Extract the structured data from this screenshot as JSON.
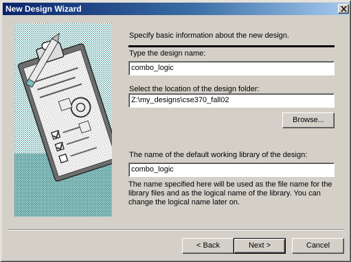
{
  "window": {
    "title": "New Design Wizard",
    "close_icon": "close-icon"
  },
  "form": {
    "intro": "Specify basic information about the new design.",
    "design_name_label": "Type the design name:",
    "design_name_value": "combo_logic",
    "location_label": "Select the location of the design folder:",
    "location_value": "Z:\\my_designs\\cse370_fall02",
    "browse_label": "Browse...",
    "library_label": "The name of the default working library of the design:",
    "library_value": "combo_logic",
    "note": "The name specified here will be used as the file name for the library files and as the logical name of the library. You can change the logical name later on."
  },
  "footer": {
    "back_label": "< Back",
    "next_label": "Next >",
    "cancel_label": "Cancel"
  },
  "colors": {
    "dialog_face": "#d4d0c8",
    "title_gradient_start": "#0a246a",
    "title_gradient_end": "#a6caf0",
    "art_teal": "#2e8b8b"
  },
  "illustration": "clipboard-checklist-illustration"
}
